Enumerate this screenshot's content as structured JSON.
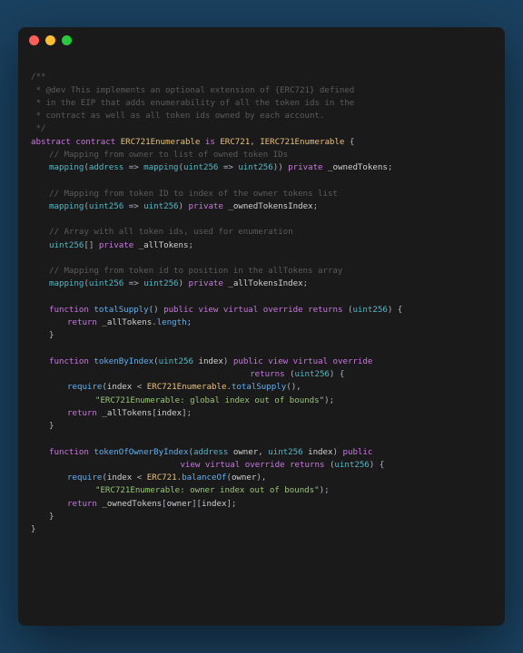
{
  "window": {
    "buttons": {
      "close": "red",
      "minimize": "yellow",
      "zoom": "green"
    }
  },
  "code": {
    "c1": "/**",
    "c2": " * @dev This implements an optional extension of {ERC721} defined",
    "c3": " * in the EIP that adds enumerability of all the token ids in the",
    "c4": " * contract as well as all token ids owned by each account.",
    "c5": " */",
    "kw_abstract": "abstract",
    "kw_contract": "contract",
    "type_main": "ERC721Enumerable",
    "kw_is": "is",
    "type_base1": "ERC721",
    "type_base2": "IERC721Enumerable",
    "brace_open": "{",
    "brace_close": "}",
    "cm1": "// Mapping from owner to list of owned token IDs",
    "kw_mapping": "mapping",
    "type_addr": "address",
    "arrow": "=>",
    "type_u256": "uint256",
    "kw_private": "private",
    "f_ownedTokens": "_ownedTokens",
    "semi": ";",
    "cm2": "// Mapping from token ID to index of the owner tokens list",
    "f_ownedTokensIndex": "_ownedTokensIndex",
    "cm3": "// Array with all token ids, used for enumeration",
    "f_allTokens": "_allTokens",
    "brackets": "[]",
    "cm4": "// Mapping from token id to position in the allTokens array",
    "f_allTokensIndex": "_allTokensIndex",
    "kw_function": "function",
    "fn_totalSupply": "totalSupply",
    "kw_public": "public",
    "kw_view": "view",
    "kw_virtual": "virtual",
    "kw_override": "override",
    "kw_returns": "returns",
    "kw_return": "return",
    "prop_length": "length",
    "fn_tokenByIndex": "tokenByIndex",
    "p_index": "index",
    "fn_require": "require",
    "str1": "\"ERC721Enumerable: global index out of bounds\"",
    "fn_tokenOfOwnerByIndex": "tokenOfOwnerByIndex",
    "p_owner": "owner",
    "type_erc721": "ERC721",
    "fn_balanceOf": "balanceOf",
    "str2": "\"ERC721Enumerable: owner index out of bounds\""
  }
}
